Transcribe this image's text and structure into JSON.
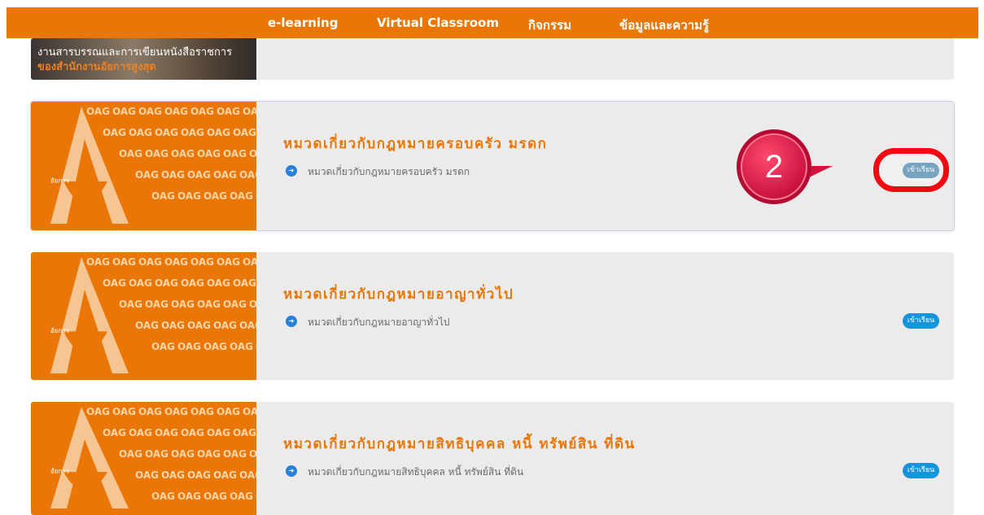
{
  "nav": {
    "items": [
      "e-learning",
      "Virtual Classroom",
      "กิจกรรม",
      "ข้อมูลและความรู้"
    ]
  },
  "top_card": {
    "banner_line1": "งานสารบรรณและการเขียนหนังสือราชการ",
    "banner_line2": "ของสำนักงานอัยการสูงสุด"
  },
  "logo_text": "OAG",
  "badge_text": "อัยการ\nช่วยได้",
  "cards": [
    {
      "title": "หมวดเกี่ยวกับกฎหมายครอบครัว มรดก",
      "subtitle": "หมวดเกี่ยวกับกฎหมายครอบครัว มรดก",
      "button": "เข้าเรียน"
    },
    {
      "title": "หมวดเกี่ยวกับกฎหมายอาญาทั่วไป",
      "subtitle": "หมวดเกี่ยวกับกฎหมายอาญาทั่วไป",
      "button": "เข้าเรียน"
    },
    {
      "title": "หมวดเกี่ยวกับกฎหมายสิทธิบุคคล หนี้ ทรัพย์สิน ที่ดิน",
      "subtitle": "หมวดเกี่ยวกับกฎหมายสิทธิบุคคล หนี้ ทรัพย์สิน ที่ดิน",
      "button": "เข้าเรียน"
    }
  ],
  "annotation": {
    "step_number": "2",
    "marker_color": "#e2164a",
    "ring_color": "#f00a12"
  },
  "colors": {
    "brand_orange": "#e97606",
    "button_blue": "#1594dc"
  }
}
